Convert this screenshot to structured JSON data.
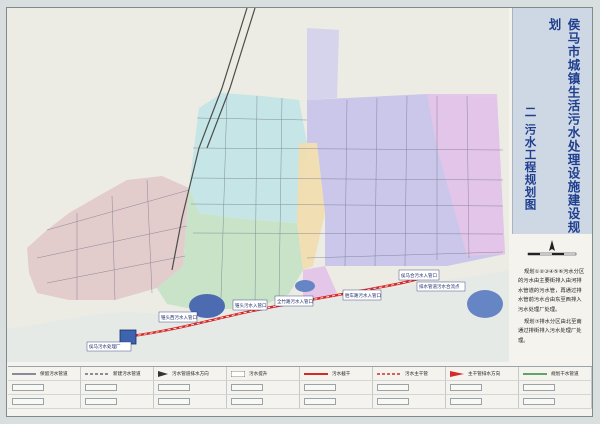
{
  "title": {
    "main": "侯马市城镇生活污水处理设施建设规划",
    "sub": "二 污水工程规划图"
  },
  "notes": [
    "规划①②③④⑤⑥污水分区的污水由主要街排入由河排水管道的污水管，再通过排水管前污水合由东至西排入污水处理厂处理。",
    "规划⑦排水分区由北至南通过排街排入污水处理厂处理。"
  ],
  "map_labels": {
    "plant": "侯马污水处理厂",
    "pump1": "锥头西污水入管口",
    "pump2": "锥头污水入管口",
    "pump3": "全竹路污水入管口",
    "pump4": "胜车路污水入管口",
    "pump5": "侯马合污水入管口",
    "outlet": "排水管道污水合流点"
  },
  "legend": [
    {
      "icon": "existing-sewer-line-icon",
      "label": "保留污水管道"
    },
    {
      "icon": "new-sewer-line-icon",
      "label": "新建污水管道"
    },
    {
      "icon": "flow-direction-arrow-icon",
      "label": "污水管道排水方向"
    },
    {
      "icon": "pump-station-icon",
      "label": "污水提升"
    },
    {
      "icon": "main-interceptor-icon",
      "label": "污水截干"
    },
    {
      "icon": "trunk-main-icon",
      "label": "污水主干管"
    },
    {
      "icon": "trunk-flow-arrow-icon",
      "label": "主干管排水方向"
    },
    {
      "icon": "planned-main-icon",
      "label": "规划干水管道"
    }
  ],
  "zones": [
    {
      "name": "zone-1",
      "color": "#e2c9c9"
    },
    {
      "name": "zone-2",
      "color": "#c4e2c4"
    },
    {
      "name": "zone-3",
      "color": "#c2e4e6"
    },
    {
      "name": "zone-4",
      "color": "#f2ddb0"
    },
    {
      "name": "zone-5",
      "color": "#c7c3ea"
    },
    {
      "name": "zone-6",
      "color": "#e4c4e8"
    },
    {
      "name": "zone-7",
      "color": "#d9d0ec"
    }
  ]
}
